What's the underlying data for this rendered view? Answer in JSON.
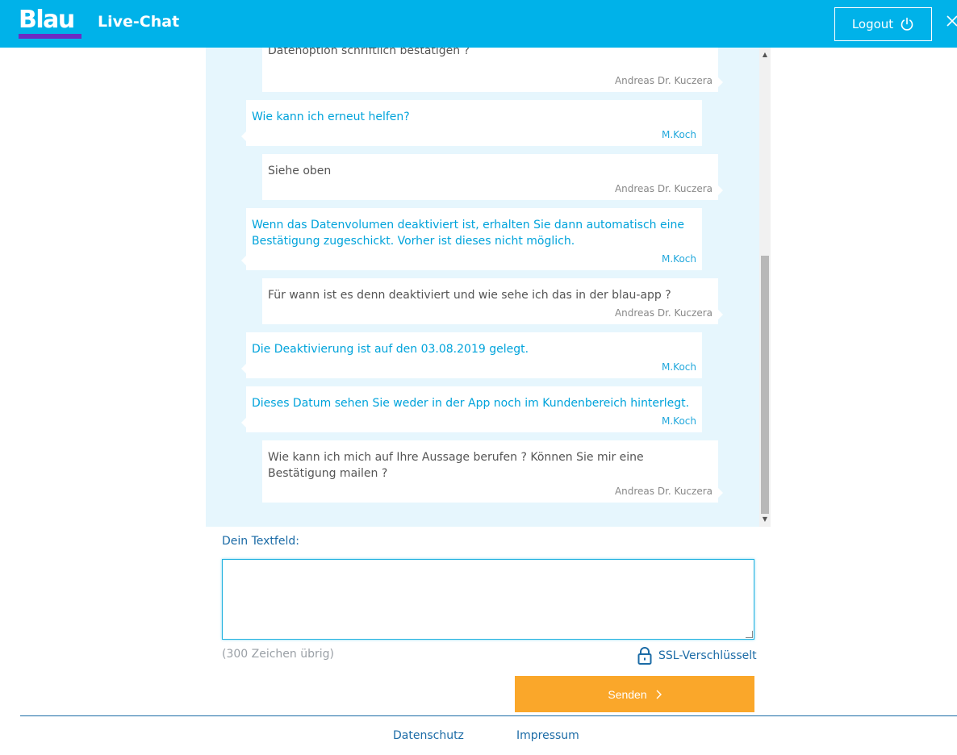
{
  "header": {
    "logo_text": "Blau",
    "title": "Live-Chat",
    "logout_label": "Logout",
    "brand_color": "#00b2e9",
    "logo_accent": "#6c2bc3"
  },
  "chat": {
    "messages": [
      {
        "role": "user",
        "text": "Datenoption schriftlich bestätigen ?",
        "author": "Andreas Dr. Kuczera"
      },
      {
        "role": "agent",
        "text": "Wie kann ich erneut helfen?",
        "author": "M.Koch"
      },
      {
        "role": "user",
        "text": "Siehe oben",
        "author": "Andreas Dr. Kuczera"
      },
      {
        "role": "agent",
        "text": "Wenn das Datenvolumen deaktiviert ist, erhalten Sie dann automatisch eine Bestätigung zugeschickt. Vorher ist dieses nicht möglich.",
        "author": "M.Koch"
      },
      {
        "role": "user",
        "text": "Für wann ist es denn deaktiviert und wie sehe ich das in der blau-app ?",
        "author": "Andreas Dr. Kuczera"
      },
      {
        "role": "agent",
        "text": "Die Deaktivierung ist auf den 03.08.2019 gelegt.",
        "author": "M.Koch"
      },
      {
        "role": "agent",
        "text": "Dieses Datum sehen Sie weder in der App noch im Kundenbereich hinterlegt.",
        "author": "M.Koch"
      },
      {
        "role": "user",
        "text": "Wie kann ich mich auf Ihre Aussage berufen ? Können Sie mir eine Bestätigung mailen ?",
        "author": "Andreas Dr. Kuczera"
      }
    ]
  },
  "form": {
    "field_label": "Dein Textfeld:",
    "textarea_value": "",
    "char_count": "(300 Zeichen übrig)",
    "ssl_label": "SSL-Verschlüsselt",
    "send_label": "Senden",
    "send_color": "#faa72a"
  },
  "footer": {
    "links": [
      "Datenschutz",
      "Impressum"
    ]
  }
}
